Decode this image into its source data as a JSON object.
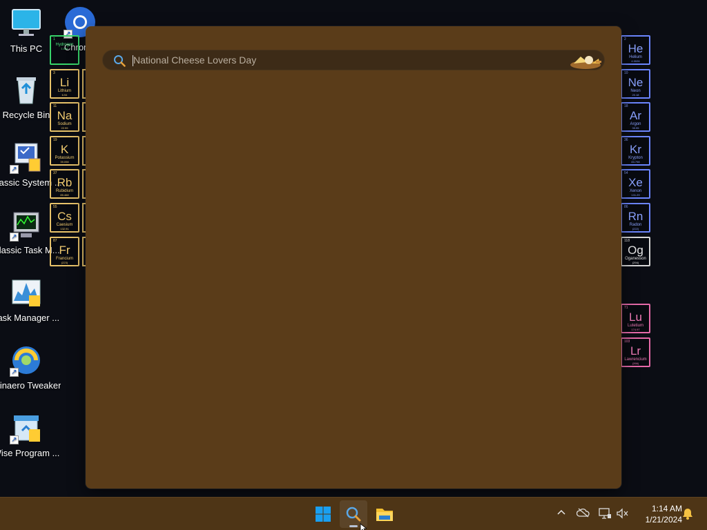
{
  "desktop": {
    "icons": [
      {
        "label": "This PC",
        "icon": "monitor-icon"
      },
      {
        "label": "Chrome",
        "icon": "chrome-icon"
      },
      {
        "label": "Recycle Bin",
        "icon": "recycle-bin-icon"
      },
      {
        "label": "Classic System ...",
        "icon": "system-icon"
      },
      {
        "label": "Classic Task M...",
        "icon": "task-manager-icon"
      },
      {
        "label": "Task Manager ...",
        "icon": "task-manager-chart-icon"
      },
      {
        "label": "Winaero Tweaker",
        "icon": "winaero-icon"
      },
      {
        "label": "Wise Program ...",
        "icon": "wise-uninstaller-icon"
      }
    ]
  },
  "periodic": {
    "left": [
      {
        "num": "1",
        "sym": "",
        "name": "Hydrogen",
        "weight": "1.008",
        "color": "green"
      },
      {
        "num": "3",
        "sym": "Li",
        "name": "Lithium",
        "weight": "6.94",
        "color": "yellow"
      },
      {
        "num": "11",
        "sym": "Na",
        "name": "Sodium",
        "weight": "22.99",
        "color": "yellow"
      },
      {
        "num": "19",
        "sym": "K",
        "name": "Potassium",
        "weight": "39.098",
        "color": "yellow"
      },
      {
        "num": "37",
        "sym": "Rb",
        "name": "Rubidium",
        "weight": "85.468",
        "color": "yellow"
      },
      {
        "num": "55",
        "sym": "Cs",
        "name": "Caesium",
        "weight": "132.91",
        "color": "yellow"
      },
      {
        "num": "87",
        "sym": "Fr",
        "name": "Francium",
        "weight": "(223)",
        "color": "yellow"
      }
    ],
    "right": [
      {
        "num": "2",
        "sym": "He",
        "name": "Helium",
        "weight": "4.0026",
        "color": "blue"
      },
      {
        "num": "10",
        "sym": "Ne",
        "name": "Neon",
        "weight": "20.18",
        "color": "blue"
      },
      {
        "num": "18",
        "sym": "Ar",
        "name": "Argon",
        "weight": "39.95",
        "color": "blue"
      },
      {
        "num": "36",
        "sym": "Kr",
        "name": "Krypton",
        "weight": "83.798",
        "color": "blue"
      },
      {
        "num": "54",
        "sym": "Xe",
        "name": "Xenon",
        "weight": "131.29",
        "color": "blue"
      },
      {
        "num": "86",
        "sym": "Rn",
        "name": "Radon",
        "weight": "(222)",
        "color": "blue"
      },
      {
        "num": "118",
        "sym": "Og",
        "name": "Oganesson",
        "weight": "(294)",
        "color": "white"
      }
    ],
    "lanthanide": [
      {
        "num": "71",
        "sym": "Lu",
        "name": "Lutetium",
        "weight": "174.97",
        "color": "pink"
      },
      {
        "num": "103",
        "sym": "Lr",
        "name": "Lawrencium",
        "weight": "(266)",
        "color": "pink"
      }
    ]
  },
  "search": {
    "placeholder": "National Cheese Lovers Day",
    "value": "",
    "search_icon": "search-icon",
    "highlight_icon": "cheese-board-icon"
  },
  "taskbar": {
    "buttons": [
      {
        "name": "start-button",
        "icon": "windows-logo-icon"
      },
      {
        "name": "search-button",
        "icon": "search-icon"
      },
      {
        "name": "file-explorer-button",
        "icon": "folder-icon"
      }
    ],
    "tray": {
      "chevron": "^",
      "time": "1:14 AM",
      "date": "1/21/2024"
    }
  },
  "colors": {
    "panel_bg": "#5a3c19",
    "taskbar_bg": "#4e3516",
    "desktop_bg": "#0b0d14"
  }
}
